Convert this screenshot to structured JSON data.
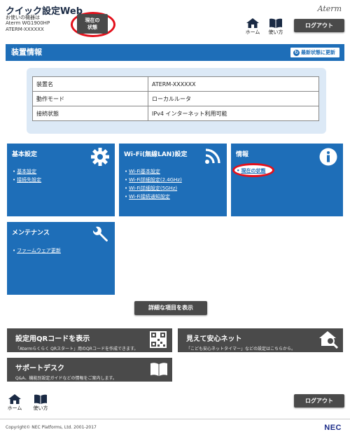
{
  "brand": {
    "title": "クイック設定Web",
    "device_line1": "お使いの機器は",
    "device_line2": "Aterm WG1900HP",
    "device_line3": "ATERM-XXXXXX",
    "logo": "Aterm"
  },
  "header": {
    "status_button": "現在の状態",
    "home_label": "ホーム",
    "manual_label": "使い方",
    "logout_label": "ログアウト"
  },
  "section": {
    "title": "装置情報",
    "refresh_label": "最新状態に更新"
  },
  "info_table": [
    {
      "label": "装置名",
      "value": "ATERM-XXXXXX"
    },
    {
      "label": "動作モード",
      "value": "ローカルルータ"
    },
    {
      "label": "接続状態",
      "value": "IPv4 インターネット利用可能"
    }
  ],
  "tiles": {
    "basic": {
      "title": "基本設定",
      "links": [
        "基本設定",
        "接続先設定"
      ],
      "icon": "gear-icon"
    },
    "wifi": {
      "title": "Wi-Fi(無線LAN)設定",
      "links": [
        "Wi-Fi基本設定",
        "Wi-Fi詳細設定(2.4GHz)",
        "Wi-Fi詳細設定(5GHz)",
        "Wi-Fi接続通知設定"
      ],
      "icon": "wifi-icon"
    },
    "info": {
      "title": "情報",
      "links": [
        "現在の状態"
      ],
      "icon": "info-icon"
    },
    "maintenance": {
      "title": "メンテナンス",
      "links": [
        "ファームウェア更新"
      ],
      "icon": "wrench-icon"
    }
  },
  "details_button": "詳細な項目を表示",
  "cards": {
    "qr": {
      "title": "設定用QRコードを表示",
      "desc": "「Atermらくらく QRスタート」用のQRコードを作成できます。",
      "icon": "qr-icon"
    },
    "safety": {
      "title": "見えて安心ネット",
      "desc": "「こども安心ネットタイマー」などの設定はこちらから。",
      "icon": "house-search-icon"
    },
    "support": {
      "title": "サポートデスク",
      "desc": "Q&A、機能別設定ガイドなどの情報をご案内します。",
      "icon": "book-icon"
    }
  },
  "footer": {
    "home_label": "ホーム",
    "manual_label": "使い方",
    "logout_label": "ログアウト",
    "copyright": "Copyright© NEC Platforms, Ltd. 2001-2017",
    "logo": "NEC"
  },
  "colors": {
    "accent_blue": "#1e6eb8",
    "dark_button": "#4a4a4a",
    "highlight_red": "#e3101b",
    "panel_bg": "#dce9f6"
  }
}
